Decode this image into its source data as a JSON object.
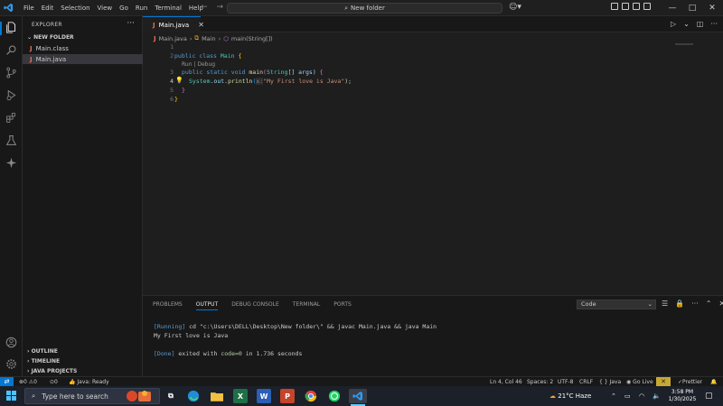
{
  "titlebar": {
    "menu": [
      "File",
      "Edit",
      "Selection",
      "View",
      "Go",
      "Run",
      "Terminal",
      "Help"
    ],
    "command_center": "New folder",
    "window_controls": [
      "—",
      "□",
      "✕"
    ]
  },
  "sidebar": {
    "header": "EXPLORER",
    "folder": "NEW FOLDER",
    "files": [
      {
        "name": "Main.class",
        "icon": "java-icon"
      },
      {
        "name": "Main.java",
        "icon": "java-icon"
      }
    ],
    "sections": [
      "OUTLINE",
      "TIMELINE",
      "JAVA PROJECTS"
    ]
  },
  "editor": {
    "tab_label": "Main.java",
    "breadcrumb": [
      "Main.java",
      "Main",
      "main(String[])"
    ],
    "codelens": "Run | Debug",
    "line_numbers": [
      "1",
      "2",
      "3",
      "4",
      "5",
      "6"
    ],
    "code": {
      "l2_kw": "public class",
      "l2_name": "Main",
      "l2_brace": "{",
      "l3_kw": "public static void",
      "l3_fn": "main",
      "l3_type": "String",
      "l3_rest": "[] args)",
      "l3_brace": "{",
      "l4_obj": "System",
      "l4_out": "out",
      "l4_fn": "println",
      "l4_hint": "x:",
      "l4_str": "\"My First love is Java\"",
      "l4_end": ");",
      "l5": "}",
      "l6": "}"
    }
  },
  "panel": {
    "tabs": [
      "PROBLEMS",
      "OUTPUT",
      "DEBUG CONSOLE",
      "TERMINAL",
      "PORTS"
    ],
    "active_tab": "OUTPUT",
    "output_channel": "Code",
    "lines": {
      "run_tag": "[Running]",
      "run_cmd": " cd \"c:\\Users\\DELL\\Desktop\\New folder\\\" && javac Main.java && java Main",
      "output": "My First love is Java",
      "done_tag": "[Done]",
      "done_mid": " exited with ",
      "done_code": "code=0",
      "done_end": " in 1.736 seconds"
    }
  },
  "statusbar": {
    "errors": "0",
    "warnings": "0",
    "ports": "0",
    "java": "Java: Ready",
    "position": "Ln 4, Col 46",
    "spaces": "Spaces: 2",
    "encoding": "UTF-8",
    "eol": "CRLF",
    "language": "{ } Java",
    "golive": "Go Live",
    "prettier": "Prettier"
  },
  "taskbar": {
    "search_placeholder": "Type here to search",
    "weather": "21°C  Haze",
    "time": "3:58 PM",
    "date": "1/30/2025"
  },
  "colors": {
    "accent": "#0078d4",
    "keyword": "#569cd6",
    "string": "#ce9178",
    "function": "#dcdcaa",
    "type": "#4ec9b0"
  }
}
